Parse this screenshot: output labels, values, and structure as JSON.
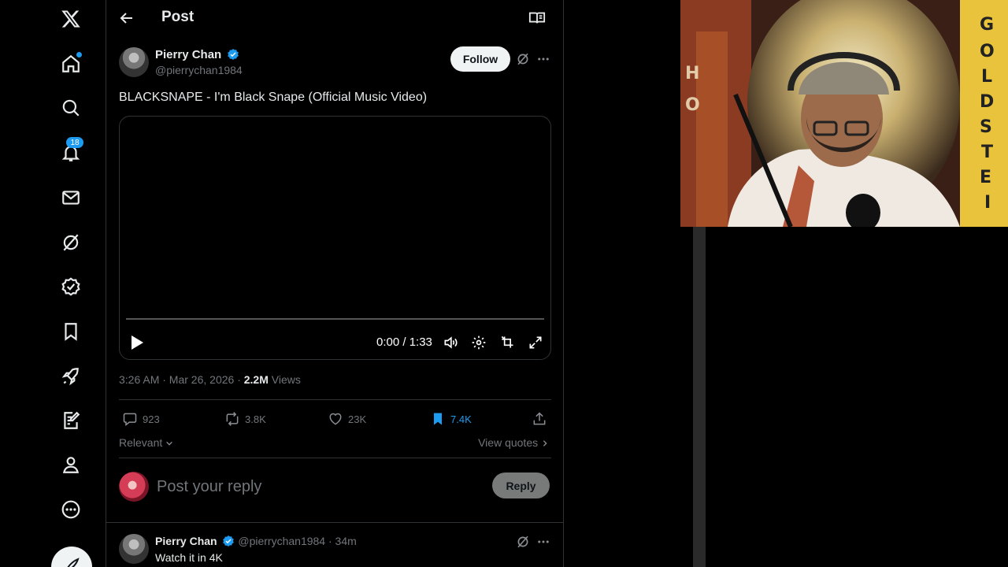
{
  "nav": {
    "notifications_badge": "18"
  },
  "header": {
    "title": "Post"
  },
  "post": {
    "author_name": "Pierry Chan",
    "author_handle": "@pierrychan1984",
    "follow_label": "Follow",
    "text": "BLACKSNAPE - I'm Black Snape (Official Music Video)",
    "video": {
      "time": "0:00 / 1:33"
    },
    "time": "3:26 AM · Mar 26, 2026 · ",
    "views_count": "2.2M",
    "views_label": " Views",
    "stats": {
      "replies": "923",
      "reposts": "3.8K",
      "likes": "23K",
      "bookmarks": "7.4K"
    }
  },
  "replies_section": {
    "sort_label": "Relevant",
    "view_quotes_label": "View quotes",
    "compose_placeholder": "Post your reply",
    "reply_button": "Reply"
  },
  "reply": {
    "author_name": "Pierry Chan",
    "handle_time": "@pierrychan1984 · 34m",
    "text": "Watch it in 4K"
  },
  "colors": {
    "accent": "#1d9bf0",
    "background": "#000000",
    "text": "#e7e9ea",
    "muted": "#71767b",
    "border": "#2f3336"
  }
}
